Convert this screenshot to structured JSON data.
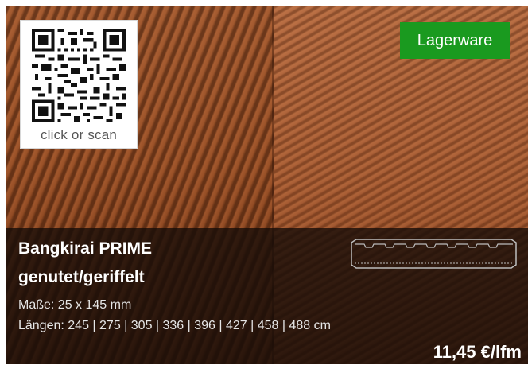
{
  "qr": {
    "caption": "click or scan"
  },
  "badge": {
    "label": "Lagerware",
    "color": "#1a9a1f"
  },
  "product": {
    "name_line1": "Bangkirai PRIME",
    "name_line2": "genutet/geriffelt",
    "dimensions": "Maße: 25 x 145  mm",
    "lengths": "Längen: 245 | 275 | 305 | 336 | 396 | 427 | 458 | 488 cm",
    "price": "11,45 €/lfm"
  },
  "icons": {
    "profile": "board-profile-icon",
    "qr": "qr-code-icon"
  }
}
